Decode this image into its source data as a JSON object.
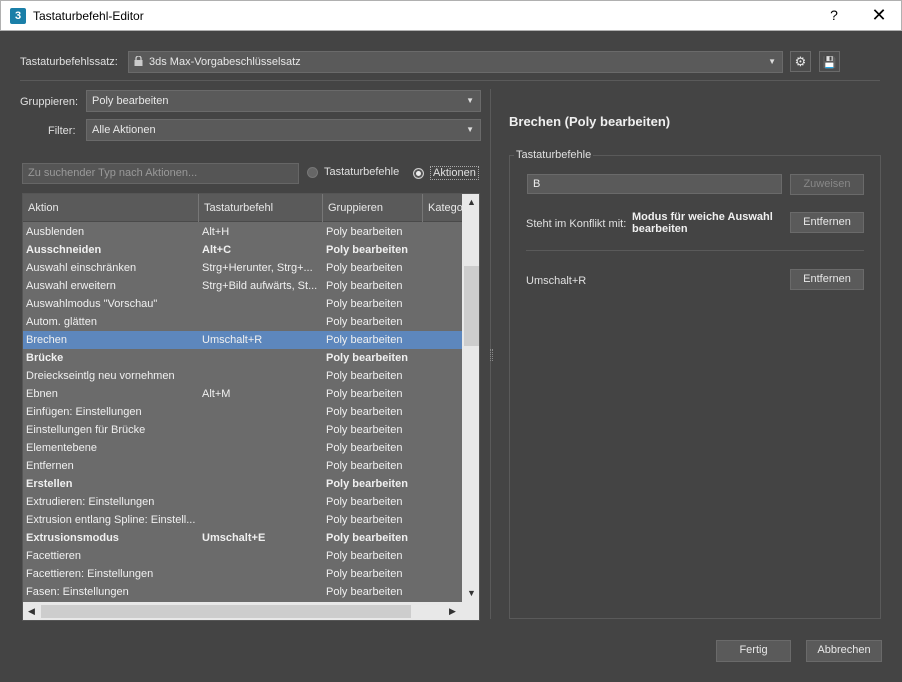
{
  "window": {
    "title": "Tastaturbefehl-Editor",
    "app_icon": "3",
    "help": "?",
    "close": "✕"
  },
  "keyset": {
    "label": "Tastaturbefehlssatz:",
    "value": "3ds Max-Vorgabeschlüsselsatz"
  },
  "group": {
    "label": "Gruppieren:",
    "value": "Poly bearbeiten"
  },
  "filter": {
    "label": "Filter:",
    "value": "Alle Aktionen"
  },
  "search": {
    "placeholder": "Zu suchender Typ nach Aktionen..."
  },
  "radios": {
    "shortcuts": "Tastaturbefehle",
    "actions": "Aktionen"
  },
  "columns": [
    "Aktion",
    "Tastaturbefehl",
    "Gruppieren",
    "Katego"
  ],
  "rows": [
    {
      "action": "Ausblenden",
      "shortcut": "Alt+H",
      "group": "Poly bearbeiten",
      "bold": false,
      "selected": false
    },
    {
      "action": "Ausschneiden",
      "shortcut": "Alt+C",
      "group": "Poly bearbeiten",
      "bold": true,
      "selected": false
    },
    {
      "action": "Auswahl einschränken",
      "shortcut": "Strg+Herunter, Strg+...",
      "group": "Poly bearbeiten",
      "bold": false,
      "selected": false
    },
    {
      "action": "Auswahl erweitern",
      "shortcut": "Strg+Bild aufwärts, St...",
      "group": "Poly bearbeiten",
      "bold": false,
      "selected": false
    },
    {
      "action": "Auswahlmodus \"Vorschau\"",
      "shortcut": "",
      "group": "Poly bearbeiten",
      "bold": false,
      "selected": false
    },
    {
      "action": "Autom. glätten",
      "shortcut": "",
      "group": "Poly bearbeiten",
      "bold": false,
      "selected": false
    },
    {
      "action": "Brechen",
      "shortcut": "Umschalt+R",
      "group": "Poly bearbeiten",
      "bold": false,
      "selected": true
    },
    {
      "action": "Brücke",
      "shortcut": "",
      "group": "Poly bearbeiten",
      "bold": true,
      "selected": false
    },
    {
      "action": "Dreieckseintlg neu vornehmen",
      "shortcut": "",
      "group": "Poly bearbeiten",
      "bold": false,
      "selected": false
    },
    {
      "action": "Ebnen",
      "shortcut": "Alt+M",
      "group": "Poly bearbeiten",
      "bold": false,
      "selected": false
    },
    {
      "action": "Einfügen: Einstellungen",
      "shortcut": "",
      "group": "Poly bearbeiten",
      "bold": false,
      "selected": false
    },
    {
      "action": "Einstellungen für Brücke",
      "shortcut": "",
      "group": "Poly bearbeiten",
      "bold": false,
      "selected": false
    },
    {
      "action": "Elementebene",
      "shortcut": "",
      "group": "Poly bearbeiten",
      "bold": false,
      "selected": false
    },
    {
      "action": "Entfernen",
      "shortcut": "",
      "group": "Poly bearbeiten",
      "bold": false,
      "selected": false
    },
    {
      "action": "Erstellen",
      "shortcut": "",
      "group": "Poly bearbeiten",
      "bold": true,
      "selected": false
    },
    {
      "action": "Extrudieren: Einstellungen",
      "shortcut": "",
      "group": "Poly bearbeiten",
      "bold": false,
      "selected": false
    },
    {
      "action": "Extrusion entlang Spline: Einstell...",
      "shortcut": "",
      "group": "Poly bearbeiten",
      "bold": false,
      "selected": false
    },
    {
      "action": "Extrusionsmodus",
      "shortcut": "Umschalt+E",
      "group": "Poly bearbeiten",
      "bold": true,
      "selected": false
    },
    {
      "action": "Facettieren",
      "shortcut": "",
      "group": "Poly bearbeiten",
      "bold": false,
      "selected": false
    },
    {
      "action": "Facettieren: Einstellungen",
      "shortcut": "",
      "group": "Poly bearbeiten",
      "bold": false,
      "selected": false
    },
    {
      "action": "Fasen: Einstellungen",
      "shortcut": "",
      "group": "Poly bearbeiten",
      "bold": false,
      "selected": false
    }
  ],
  "detail": {
    "title": "Brechen (Poly bearbeiten)",
    "group_title": "Tastaturbefehle",
    "input_value": "B",
    "assign_label": "Zuweisen",
    "conflict_label": "Steht im Konflikt mit:",
    "conflict_value": "Modus für weiche Auswahl bearbeiten",
    "remove_label": "Entfernen",
    "existing_shortcut": "Umschalt+R",
    "remove2_label": "Entfernen"
  },
  "footer": {
    "ok_label": "Fertig",
    "cancel_label": "Abbrechen"
  },
  "colors": {
    "background": "#444444",
    "selection": "#5d87bd",
    "table_bg": "#6b6b6b"
  }
}
